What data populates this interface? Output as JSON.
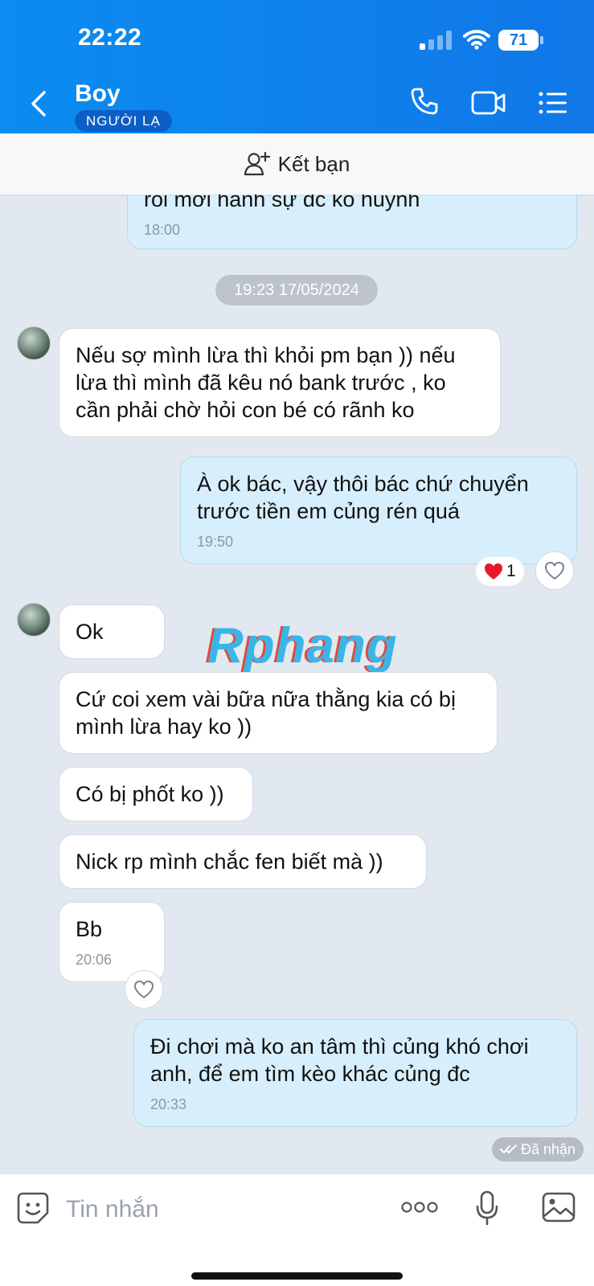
{
  "status_bar": {
    "time": "22:22",
    "battery": "71"
  },
  "header": {
    "contact_name": "Boy",
    "badge": "NGƯỜI LẠ"
  },
  "friend_bar": {
    "label": "Kết bạn"
  },
  "date_divider": "19:23 17/05/2024",
  "messages": [
    {
      "dir": "out",
      "text": "rồi mới hành sự đc ko huynh",
      "time": "18:00"
    },
    {
      "dir": "in",
      "text": "Nếu sợ mình lừa thì khỏi pm bạn )) nếu lừa thì mình đã kêu nó bank trước , ko cần phải chờ hỏi con bé có rãnh ko"
    },
    {
      "dir": "out",
      "text": "À ok bác, vậy thôi bác chứ chuyển trước tiền em củng rén quá",
      "time": "19:50"
    },
    {
      "dir": "in",
      "text": "Ok"
    },
    {
      "dir": "in",
      "text": "Cứ coi xem vài bữa nữa thằng kia có bị mình lừa hay ko ))"
    },
    {
      "dir": "in",
      "text": "Có bị phốt ko ))"
    },
    {
      "dir": "in",
      "text": "Nick rp mình chắc fen biết mà ))"
    },
    {
      "dir": "in",
      "text": "Bb",
      "time": "20:06"
    },
    {
      "dir": "out",
      "text": "Đi chơi mà ko an tâm thì củng khó chơi anh, để em tìm kèo khác củng đc",
      "time": "20:33"
    }
  ],
  "reaction": {
    "count": "1"
  },
  "watermark": "Rphang",
  "delivery_status": "Đã nhận",
  "composer": {
    "placeholder": "Tin nhắn"
  }
}
